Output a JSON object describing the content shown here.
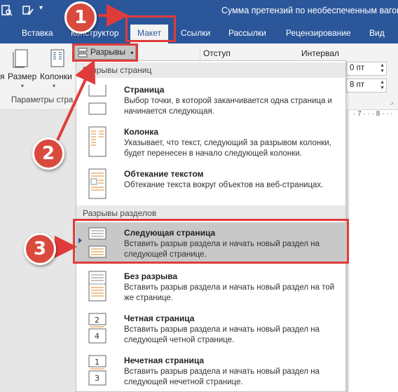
{
  "window": {
    "title": "Сумма претензий по необеспеченным вагона"
  },
  "tabs": [
    {
      "label": "Вставка"
    },
    {
      "label": "Конструктор"
    },
    {
      "label": "Макет"
    },
    {
      "label": "Ссылки"
    },
    {
      "label": "Рассылки"
    },
    {
      "label": "Рецензирование"
    },
    {
      "label": "Вид"
    }
  ],
  "ribbon": {
    "orientation_partial": "я",
    "size_label": "Размер",
    "columns_label": "Колонки",
    "breaks_label": "Разрывы",
    "indent_label": "Отступ",
    "interval_label": "Интервал",
    "before_value": "0 пт",
    "after_value": "8 пт",
    "group_label": "Параметры стра",
    "ruler_text": "· 7 · · · 8 · · ·"
  },
  "dropdown": {
    "page_breaks_header": "Разрывы страниц",
    "section_breaks_header": "Разрывы разделов",
    "items": [
      {
        "title": "Страница",
        "desc": "Выбор точки, в которой заканчивается одна страница и начинается следующая.",
        "icon": "page-break-icon"
      },
      {
        "title": "Колонка",
        "desc": "Указывает, что текст, следующий за разрывом колонки, будет перенесен в начало следующей колонки.",
        "icon": "column-break-icon"
      },
      {
        "title": "Обтекание текстом",
        "desc": "Обтекание текста вокруг объектов на веб-страницах.",
        "icon": "text-wrapping-icon"
      },
      {
        "title": "Следующая страница",
        "desc": "Вставить разрыв раздела и начать новый раздел на следующей странице.",
        "icon": "next-page-icon"
      },
      {
        "title": "Без разрыва",
        "desc": "Вставить разрыв раздела и начать новый раздел на той же странице.",
        "icon": "continuous-icon"
      },
      {
        "title": "Четная страница",
        "desc": "Вставить разрыв раздела и начать новый раздел на следующей четной странице.",
        "icon": "even-page-icon"
      },
      {
        "title": "Нечетная страница",
        "desc": "Вставить разрыв раздела и начать новый раздел на следующей нечетной странице.",
        "icon": "odd-page-icon"
      }
    ]
  },
  "annotations": {
    "step1": "1",
    "step2": "2",
    "step3": "3",
    "color": "#d94a3d"
  },
  "colors": {
    "brand": "#2b579a",
    "highlight": "#c8c8c8",
    "annotation_red": "#e03b3b"
  }
}
